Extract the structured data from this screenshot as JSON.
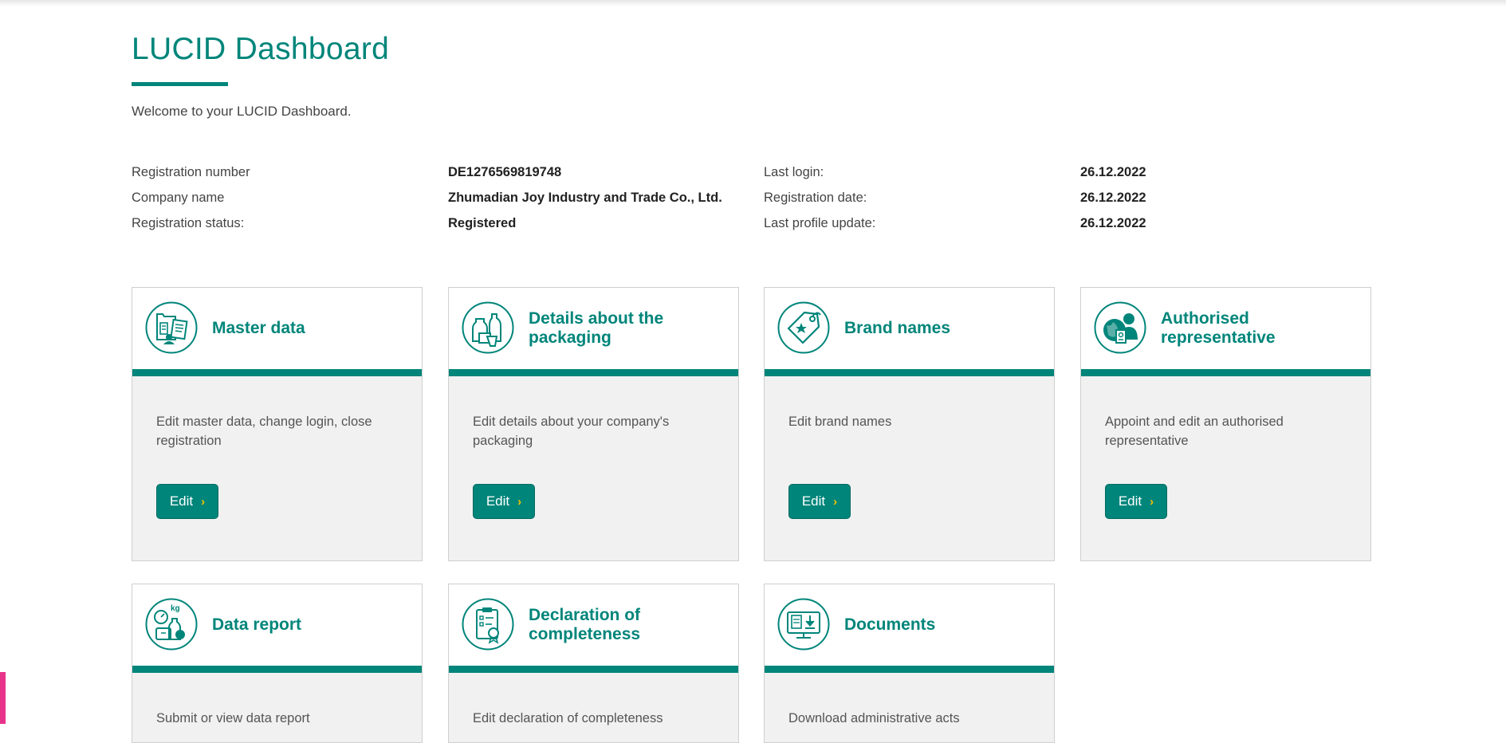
{
  "page": {
    "title": "LUCID Dashboard",
    "welcome": "Welcome to your LUCID Dashboard."
  },
  "info": {
    "registration_number_label": "Registration number",
    "registration_number": "DE1276569819748",
    "company_name_label": "Company name",
    "company_name": "Zhumadian Joy Industry and Trade Co., Ltd.",
    "registration_status_label": "Registration status:",
    "registration_status": "Registered",
    "last_login_label": "Last login:",
    "last_login": "26.12.2022",
    "registration_date_label": "Registration date:",
    "registration_date": "26.12.2022",
    "last_profile_update_label": "Last profile update:",
    "last_profile_update": "26.12.2022"
  },
  "cards": [
    {
      "title": "Master data",
      "icon": "master-data-icon",
      "description": "Edit master data, change login, close registration",
      "button": "Edit"
    },
    {
      "title": "Details about the packaging",
      "icon": "packaging-icon",
      "description": "Edit details about your company's packaging",
      "button": "Edit"
    },
    {
      "title": "Brand names",
      "icon": "brand-tag-icon",
      "description": "Edit brand names",
      "button": "Edit"
    },
    {
      "title": "Authorised representative",
      "icon": "representative-icon",
      "description": "Appoint and edit an authorised representative",
      "button": "Edit"
    },
    {
      "title": "Data report",
      "icon": "data-report-icon",
      "description": "Submit or view data report"
    },
    {
      "title": "Declaration of completeness",
      "icon": "declaration-icon",
      "description": "Edit declaration of completeness"
    },
    {
      "title": "Documents",
      "icon": "documents-icon",
      "description": "Download administrative acts"
    }
  ],
  "colors": {
    "accent": "#00857a",
    "button_chevron": "#f5c400",
    "card_bg": "#f1f1f1",
    "side_tab": "#e8338b"
  }
}
